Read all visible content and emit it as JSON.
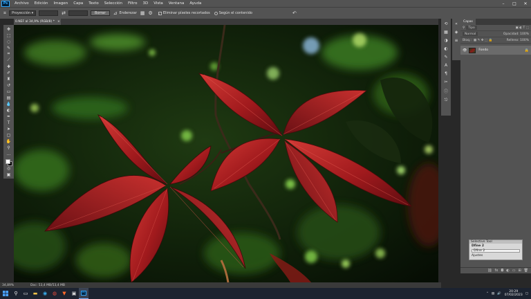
{
  "app": {
    "logo": "Ps",
    "menu": [
      "Archivo",
      "Edición",
      "Imagen",
      "Capa",
      "Texto",
      "Selección",
      "Filtro",
      "3D",
      "Vista",
      "Ventana",
      "Ayuda"
    ],
    "window_controls": [
      "–",
      "□",
      "✕"
    ]
  },
  "options": {
    "select_value": "Proyección",
    "erase_button": "Borrar",
    "straighten_label": "Enderezar",
    "delete_cropped_label": "Eliminar píxeles recortados",
    "content_aware_label": "Según el contenido"
  },
  "document": {
    "tab_title": "0.NEF al 34,9% (RGB/8) *",
    "tab_close": "×"
  },
  "status": {
    "zoom": "34,89%",
    "doc_info": "Doc: 53,4 MB/53,4 MB"
  },
  "layers_panel": {
    "tabs": [
      "Capas"
    ],
    "filter_label": "Tipo",
    "mode": "Normal",
    "opacity_label": "Opacidad: 100%",
    "lock_label": "Bloq.:",
    "fill_label": "Relleno: 100%",
    "layer_name": "Fondo"
  },
  "popup": {
    "title": "Selective Tool",
    "line1": "Dfine 2",
    "line2": "Dfine 2",
    "line3": "Ajustes"
  },
  "taskbar": {
    "search_icon": "search-icon",
    "time": "20:29",
    "date": "07/02/2023"
  },
  "colors": {
    "ui_dark": "#535353",
    "panel_bg": "#3a3a3a",
    "leaf_red": "#b41f1f",
    "foliage_green": "#2d5a1b",
    "taskbar": "#1c2330"
  }
}
